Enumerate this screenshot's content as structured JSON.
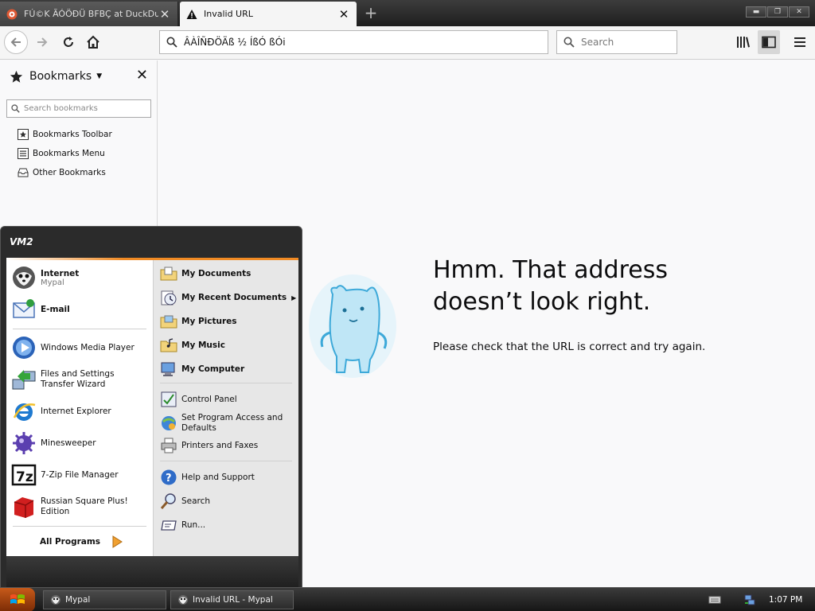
{
  "tabs": [
    {
      "title": "FÚ©K ÃÓÖÐÜ BFBÇ at DuckDuckGo",
      "active": false,
      "icon": "duckduckgo-icon"
    },
    {
      "title": "Invalid URL",
      "active": true,
      "icon": "warning-icon"
    }
  ],
  "navbar": {
    "url": "ÂÀÎÑÐÖÄß ½ ÍßÓ ßÓi",
    "search_placeholder": "Search"
  },
  "sidebar": {
    "title": "Bookmarks",
    "search_placeholder": "Search bookmarks",
    "items": [
      {
        "label": "Bookmarks Toolbar",
        "icon": "bookmarks-toolbar-icon"
      },
      {
        "label": "Bookmarks Menu",
        "icon": "bookmarks-menu-icon"
      },
      {
        "label": "Other Bookmarks",
        "icon": "other-bookmarks-icon"
      }
    ]
  },
  "error_page": {
    "title": "Hmm. That address doesn’t look right.",
    "description": "Please check that the URL is correct and try again."
  },
  "start_menu": {
    "user": "VM2",
    "pinned": [
      {
        "label": "Internet",
        "sub": "Mypal",
        "icon": "mypal-icon"
      },
      {
        "label": "E-mail",
        "sub": "",
        "icon": "email-icon"
      }
    ],
    "recent": [
      {
        "label": "Windows Media Player",
        "icon": "media-player-icon"
      },
      {
        "label": "Files and Settings Transfer Wizard",
        "icon": "transfer-wizard-icon"
      },
      {
        "label": "Internet Explorer",
        "icon": "internet-explorer-icon"
      },
      {
        "label": "Minesweeper",
        "icon": "minesweeper-icon"
      },
      {
        "label": "7-Zip File Manager",
        "icon": "7zip-icon"
      },
      {
        "label": "Russian Square Plus! Edition",
        "icon": "russian-square-icon"
      }
    ],
    "all_programs": "All Programs",
    "places": [
      {
        "label": "My Documents",
        "icon": "my-documents-icon",
        "arrow": false
      },
      {
        "label": "My Recent Documents",
        "icon": "recent-documents-icon",
        "arrow": true
      },
      {
        "label": "My Pictures",
        "icon": "my-pictures-icon",
        "arrow": false
      },
      {
        "label": "My Music",
        "icon": "my-music-icon",
        "arrow": false
      },
      {
        "label": "My Computer",
        "icon": "my-computer-icon",
        "arrow": false
      }
    ],
    "system": [
      {
        "label": "Control Panel",
        "icon": "control-panel-icon"
      },
      {
        "label": "Set Program Access and Defaults",
        "icon": "program-access-icon"
      },
      {
        "label": "Printers and Faxes",
        "icon": "printer-icon"
      }
    ],
    "help": [
      {
        "label": "Help and Support",
        "icon": "help-icon"
      },
      {
        "label": "Search",
        "icon": "search-icon"
      },
      {
        "label": "Run...",
        "icon": "run-icon"
      }
    ]
  },
  "taskbar": {
    "buttons": [
      {
        "label": "Mypal",
        "icon": "mypal-icon"
      },
      {
        "label": "Invalid URL - Mypal",
        "icon": "mypal-icon"
      }
    ],
    "clock": "1:07 PM"
  }
}
